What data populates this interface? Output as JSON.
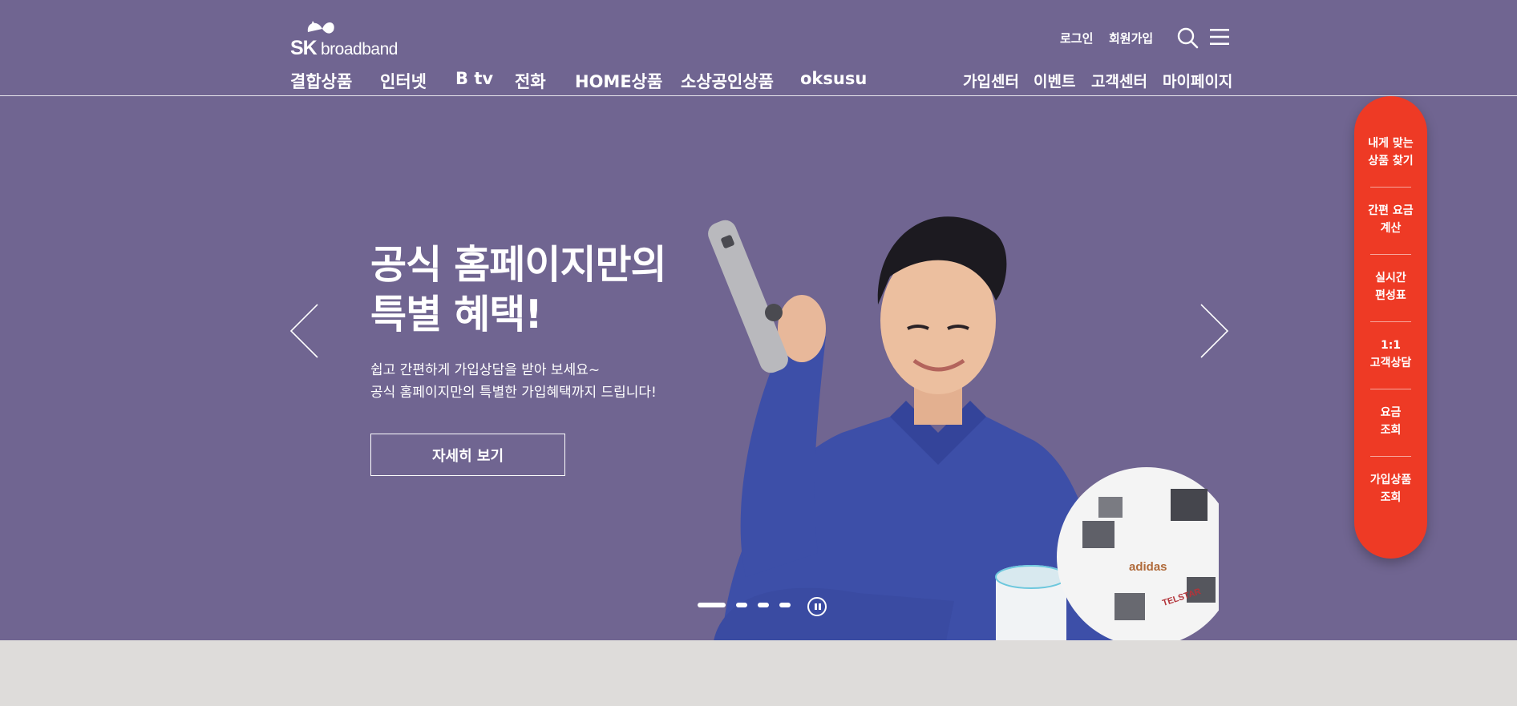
{
  "brand": {
    "logo_sk": "SK",
    "logo_text": "broadband"
  },
  "utility": {
    "login": "로그인",
    "join": "회원가입"
  },
  "gnb_left": [
    "결합상품",
    "인터넷",
    "B tv",
    "전화",
    "HOME상품",
    "소상공인상품",
    "oksusu"
  ],
  "gnb_right": [
    "가입센터",
    "이벤트",
    "고객센터",
    "마이페이지"
  ],
  "slide": {
    "title_line1": "공식 홈페이지만의",
    "title_line2": "특별 혜택!",
    "desc_line1": "쉽고 간편하게 가입상담을 받아 보세요~",
    "desc_line2": "공식 홈페이지만의 특별한 가입혜택까지 드립니다!",
    "button": "자세히 보기"
  },
  "pager": {
    "total": 4,
    "active": 1
  },
  "quick_menu": [
    {
      "line1": "내게 맞는",
      "line2": "상품 찾기"
    },
    {
      "line1": "간편 요금",
      "line2": "계산"
    },
    {
      "line1": "실시간",
      "line2": "편성표"
    },
    {
      "line1": "1:1",
      "line2": "고객상담"
    },
    {
      "line1": "요금",
      "line2": "조회"
    },
    {
      "line1": "가입상품",
      "line2": "조회"
    }
  ],
  "ball_text": {
    "brand": "adidas",
    "name": "TELSTAR"
  },
  "colors": {
    "hero_bg": "#706591",
    "quick_bg": "#ee3a25",
    "footer_bg": "#dedcda",
    "shirt": "#3d4fa8"
  },
  "icons": {
    "search": "search-icon",
    "menu": "hamburger-icon",
    "prev": "chevron-left-icon",
    "next": "chevron-right-icon",
    "pause": "pause-icon"
  }
}
